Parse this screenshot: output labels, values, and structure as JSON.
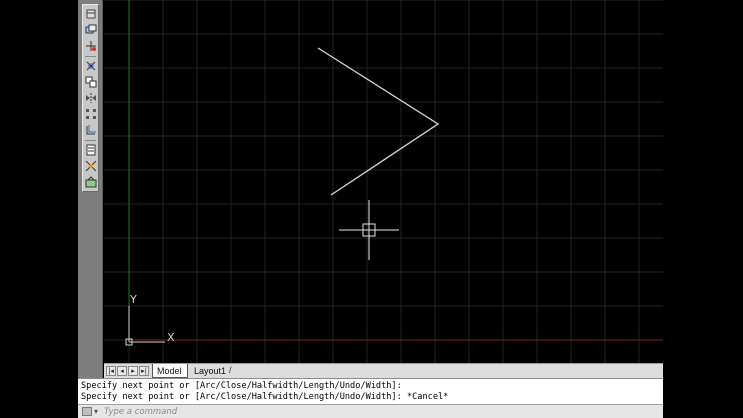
{
  "toolbar": {
    "tools": [
      {
        "name": "rectangle-tool-icon"
      },
      {
        "name": "layer-tool-icon"
      },
      {
        "name": "move-tool-icon"
      },
      {
        "name": "trim-tool-icon"
      },
      {
        "name": "copy-tool-icon"
      },
      {
        "name": "mirror-tool-icon"
      },
      {
        "name": "array-tool-icon"
      },
      {
        "name": "offset-tool-icon"
      },
      {
        "name": "properties-tool-icon"
      },
      {
        "name": "explode-tool-icon"
      },
      {
        "name": "block-tool-icon"
      }
    ]
  },
  "viewport": {
    "background": "#000000",
    "grid_color": "#1c2a1c",
    "polyline_color": "#d8d8d8",
    "ucs_labels": {
      "x": "X",
      "y": "Y"
    }
  },
  "tabs": {
    "nav_buttons": [
      "|◂",
      "◂",
      "▸",
      "▸|"
    ],
    "items": [
      {
        "label": "Model",
        "active": true
      },
      {
        "label": "Layout1",
        "active": false
      }
    ],
    "trailing": "/"
  },
  "command": {
    "history": [
      "Specify next point or [Arc/Close/Halfwidth/Length/Undo/Width]:",
      "Specify next point or [Arc/Close/Halfwidth/Length/Undo/Width]: *Cancel*"
    ],
    "input_placeholder": "Type a command",
    "input_value": ""
  }
}
